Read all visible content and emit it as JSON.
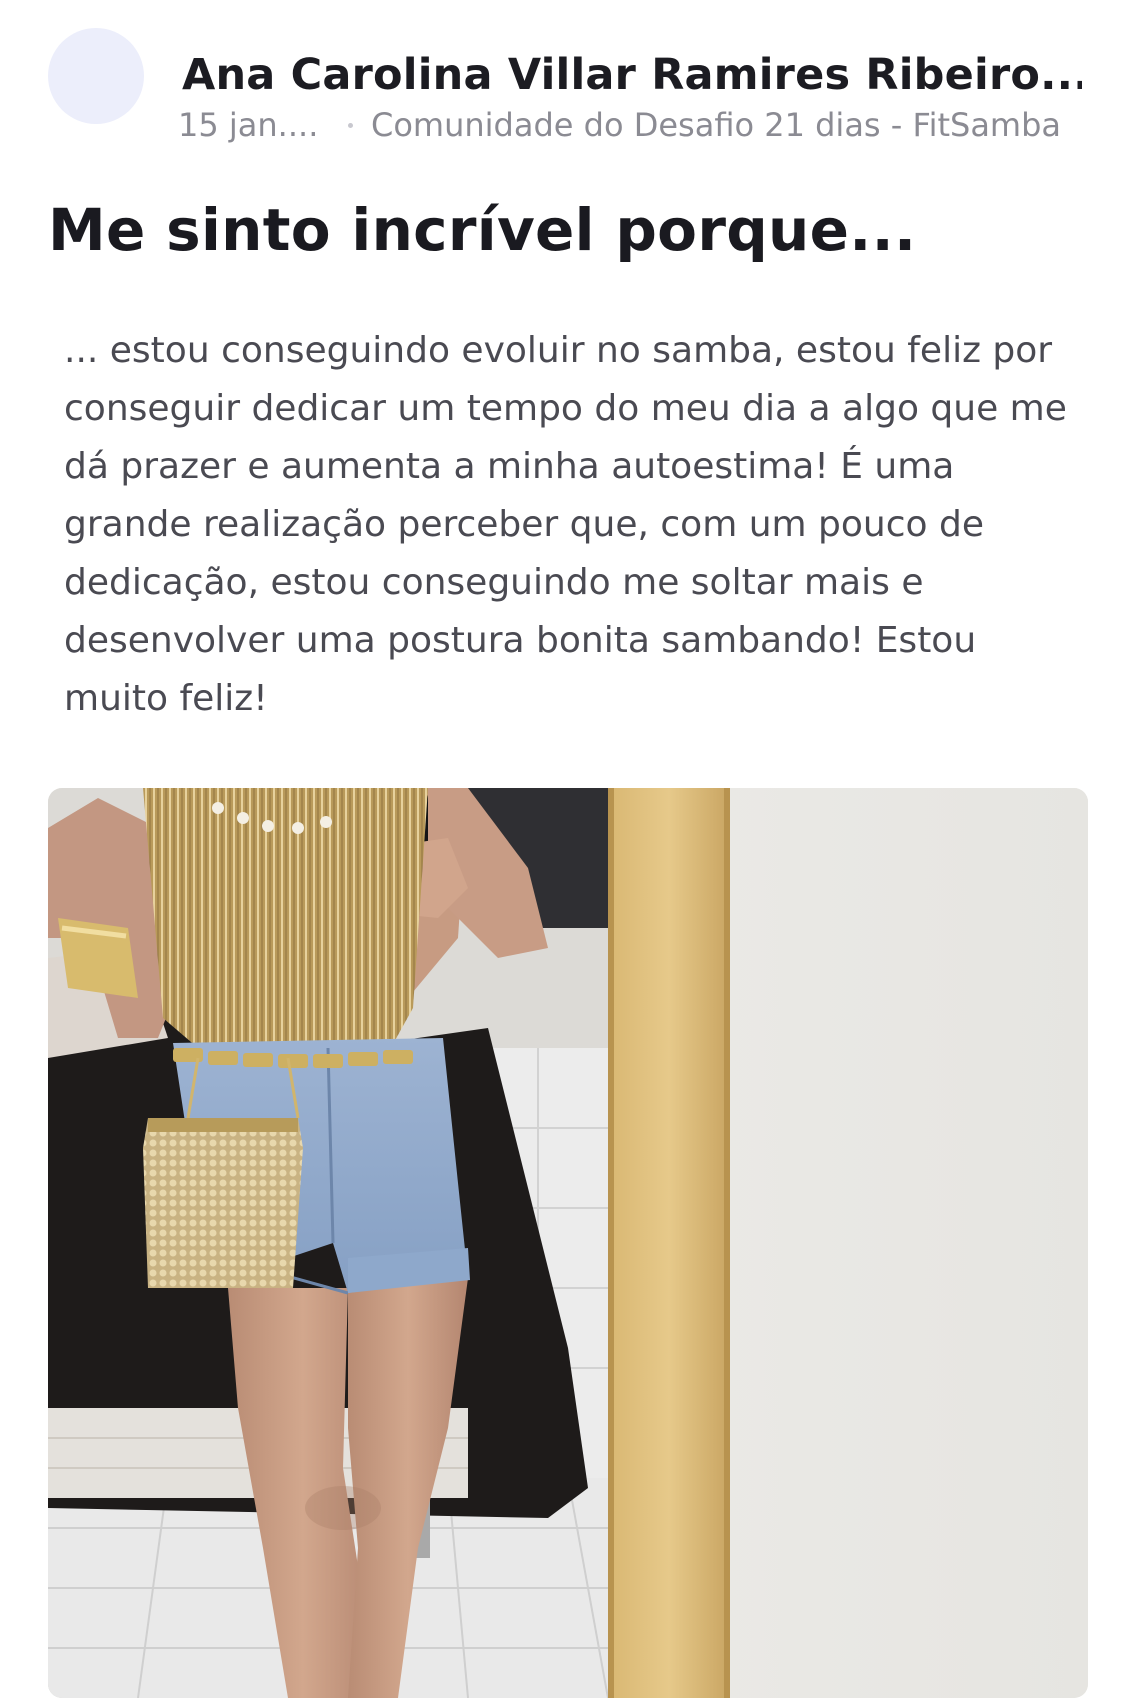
{
  "post": {
    "author_name": "Ana Carolina Villar Ramires Ribeiro...",
    "date": "15 jan....",
    "community": "Comunidade do Desafio 21 dias - FitSamba",
    "title": "Me sinto incrível porque...",
    "body": "... estou conseguindo evoluir no samba, estou feliz por conseguir dedicar um tempo do meu dia a algo que me dá prazer e aumenta a minha autoestima! É uma grande realização perceber que, com um pouco de dedicação, estou conseguindo me soltar mais e desenvolver uma postura bonita sambando! Estou muito feliz!"
  },
  "colors": {
    "avatar_bg": "#eceefb",
    "meta_text": "#8b8b93",
    "body_text": "#4a4a52",
    "title_text": "#1a1a20"
  }
}
